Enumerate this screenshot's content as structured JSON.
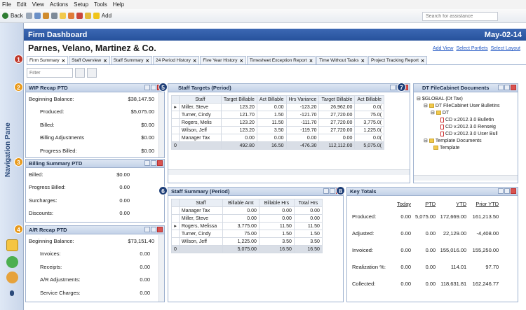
{
  "menu": [
    "File",
    "Edit",
    "View",
    "Actions",
    "Setup",
    "Tools",
    "Help"
  ],
  "toolbar": {
    "back": "Back",
    "add": "Add",
    "search_placeholder": "Search for assistance"
  },
  "nav": {
    "label": "Navigation Pane"
  },
  "header": {
    "title": "Firm Dashboard",
    "date": "May-02-14"
  },
  "firm": {
    "name": "Parnes, Velano, Martinez & Co.",
    "links": [
      "Add View",
      "Select Portlets",
      "Select Layout"
    ]
  },
  "tabs": [
    "Firm Summary",
    "Staff Overview",
    "Staff Summary",
    "24 Period History",
    "Five Year History",
    "Timesheet Exception Report",
    "Time Without Tasks",
    "Project Tracking Report"
  ],
  "filter": {
    "placeholder": "Filter"
  },
  "markers": [
    "1",
    "2",
    "3",
    "4",
    "5",
    "6",
    "7",
    "8"
  ],
  "wip": {
    "title": "WIP Recap PTD",
    "rows": [
      [
        "Beginning Balance:",
        "$38,147.50"
      ],
      [
        "Produced:",
        "$5,075.00"
      ],
      [
        "Billed:",
        "$0.00"
      ],
      [
        "Billing Adjustments",
        "$0.00"
      ],
      [
        "Progress Billed:",
        "$0.00"
      ]
    ]
  },
  "billing": {
    "title": "Billing Summary PTD",
    "rows": [
      [
        "Billed:",
        "$0.00"
      ],
      [
        "Progress Billed:",
        "0.00"
      ],
      [
        "Surcharges:",
        "0.00"
      ],
      [
        "Discounts:",
        "0.00"
      ]
    ]
  },
  "ar": {
    "title": "A/R Recap PTD",
    "rows": [
      [
        "Beginning Balance:",
        "$73,151.40"
      ],
      [
        "Invoices:",
        "0.00"
      ],
      [
        "Receipts:",
        "0.00"
      ],
      [
        "A/R Adjustments:",
        "0.00"
      ],
      [
        "Service Charges:",
        "0.00"
      ]
    ]
  },
  "targets": {
    "title": "Staff Targets  (Period)",
    "headers": [
      "Staff",
      "Target Billable",
      "Act Billable",
      "Hrs Variance",
      "Target Billable",
      "Act Billable"
    ],
    "rows": [
      [
        "Miller, Steve",
        "123.20",
        "0.00",
        "-123.20",
        "26,962.00",
        "0.0("
      ],
      [
        "Turner, Cindy",
        "121.70",
        "1.50",
        "-121.70",
        "27,720.00",
        "75.0("
      ],
      [
        "Rogers, Melis",
        "123.20",
        "11.50",
        "-111.70",
        "27,720.00",
        "3,775.0("
      ],
      [
        "Wilson, Jeff",
        "123.20",
        "3.50",
        "-119.70",
        "27,720.00",
        "1,225.0("
      ],
      [
        "Manager Tax",
        "0.00",
        "0.00",
        "0.00",
        "0.00",
        "0.0("
      ]
    ],
    "total": [
      "0",
      "492.80",
      "16.50",
      "-476.30",
      "112,112.00",
      "5,075.0("
    ]
  },
  "summary": {
    "title": "Staff Summary  (Period)",
    "headers": [
      "Staff",
      "Billable Amt",
      "Billable Hrs",
      "Total Hrs"
    ],
    "rows": [
      [
        "Manager Tax",
        "0.00",
        "0.00",
        "0.00"
      ],
      [
        "Miller, Steve",
        "0.00",
        "0.00",
        "0.00"
      ],
      [
        "Rogers, Melissa",
        "3,775.00",
        "11.50",
        "11.50"
      ],
      [
        "Turner, Cindy",
        "75.00",
        "1.50",
        "1.50"
      ],
      [
        "Wilson, Jeff",
        "1,225.00",
        "3.50",
        "3.50"
      ]
    ],
    "total": [
      "0",
      "5,075.00",
      "16.50",
      "16.50"
    ]
  },
  "cabinet": {
    "title": "DT FileCabinet Documents",
    "tree": [
      "$GLOBAL (Dt Tax)",
      "DT FileCabinet User Bulletins",
      "DT",
      "CD v.2012.3.0 Bulletin",
      "CD v.2012.3.0 Renseig",
      "CD v.2012.3.0 User Bull",
      "Template Documents",
      "Template"
    ]
  },
  "keytotals": {
    "title": "Key Totals",
    "headers": [
      "Today",
      "PTD",
      "YTD",
      "Prior YTD"
    ],
    "rows": [
      [
        "Produced:",
        "0.00",
        "5,075.00",
        "172,669.00",
        "161,213.50"
      ],
      [
        "Adjusted:",
        "0.00",
        "0.00",
        "22,129.00",
        "-4,408.00"
      ],
      [
        "Invoiced:",
        "0.00",
        "0.00",
        "155,016.00",
        "155,250.00"
      ],
      [
        "Realization %:",
        "0.00",
        "0.00",
        "114.01",
        "97.70"
      ],
      [
        "Collected:",
        "0.00",
        "0.00",
        "118,631.81",
        "162,246.77"
      ]
    ]
  },
  "colors": {
    "header": "#2f5ca8",
    "marker": "#c0392b",
    "marker_blue": "#1f3f78",
    "marker_orange": "#e89a1c"
  }
}
